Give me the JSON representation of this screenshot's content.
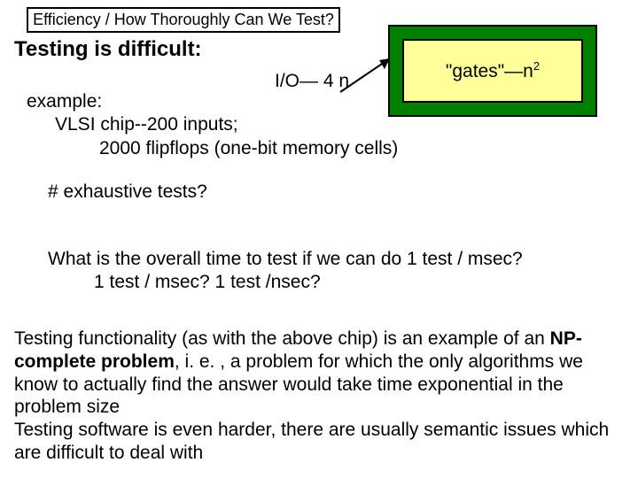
{
  "title": "Efficiency / How Thoroughly Can We Test?",
  "heading": "Testing is difficult:",
  "io_label": "I/O— 4 n",
  "chip_label_pre": "\"gates\"—n",
  "chip_label_sup": "2",
  "example": {
    "l1": "example:",
    "l2": "VLSI chip--200 inputs;",
    "l3": "2000 flipflops (one-bit memory cells)"
  },
  "exhaustive": "# exhaustive tests?",
  "overall": {
    "l1": "What is the overall time to test if we can do 1 test / msec?",
    "l2": "1 test / msec?  1 test /nsec?"
  },
  "paragraph_pre": "Testing functionality (as with the above chip) is an example of an ",
  "paragraph_bold": "NP-complete problem",
  "paragraph_post": ", i. e. , a problem for which the only algorithms we know to actually find the answer would take time exponential in the problem size",
  "paragraph2": "Testing software is even harder, there are usually semantic issues which are difficult to deal with"
}
